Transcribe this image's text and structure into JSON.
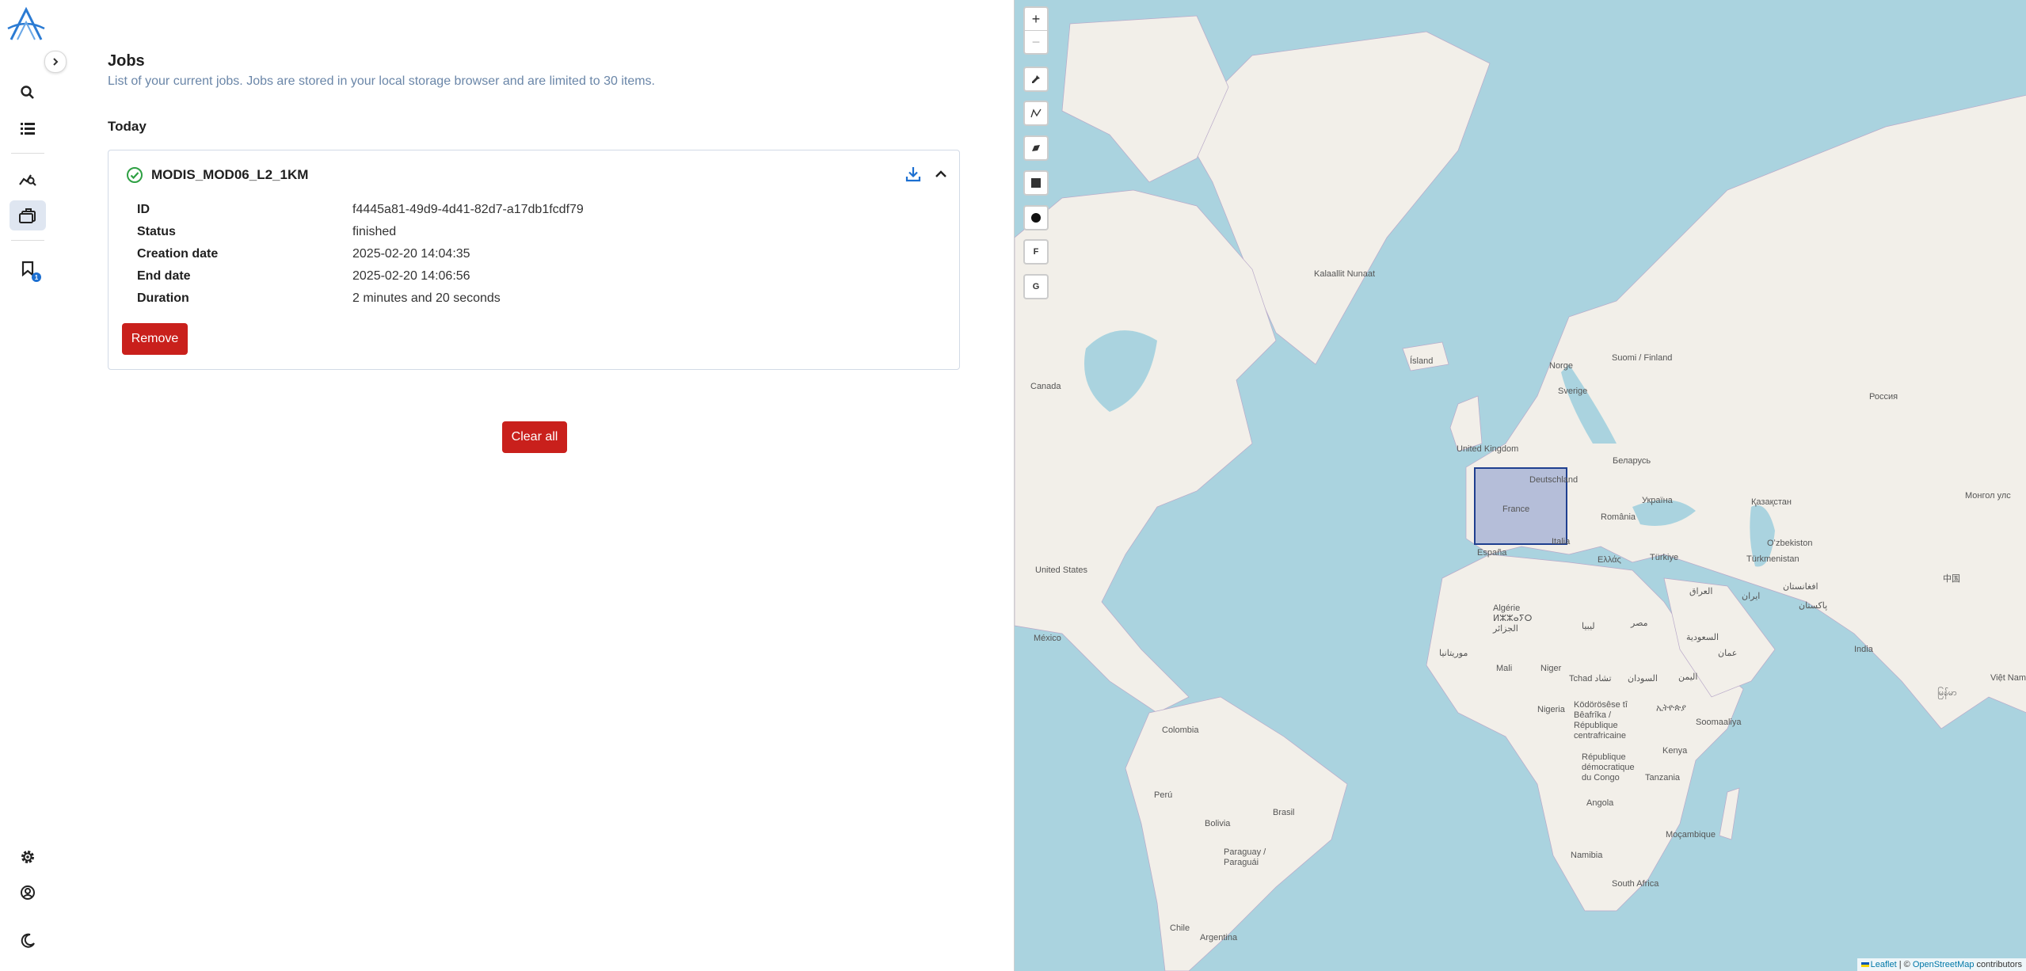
{
  "app": {
    "logo_icon": "app-logo-icon"
  },
  "rail": {
    "expand_icon": "chevron-right-icon",
    "items": [
      {
        "icon": "search-icon"
      },
      {
        "icon": "layers-list-icon"
      },
      {
        "icon": "analytics-icon"
      },
      {
        "icon": "jobs-briefcase-icon",
        "active": true
      },
      {
        "icon": "bookmark-icon",
        "badge": "1"
      }
    ],
    "bottom": [
      {
        "icon": "gear-icon"
      },
      {
        "icon": "user-account-icon"
      },
      {
        "icon": "dark-mode-moon-icon"
      }
    ]
  },
  "jobs": {
    "title": "Jobs",
    "subtitle": "List of your current jobs. Jobs are stored in your local storage browser and are limited to 30 items.",
    "section": "Today",
    "job": {
      "name": "MODIS_MOD06_L2_1KM",
      "status_icon": "check-circle-icon",
      "fields": [
        {
          "label": "ID",
          "value": "f4445a81-49d9-4d41-82d7-a17db1fcdf79"
        },
        {
          "label": "Status",
          "value": "finished"
        },
        {
          "label": "Creation date",
          "value": "2025-02-20 14:04:35"
        },
        {
          "label": "End date",
          "value": "2025-02-20 14:06:56"
        },
        {
          "label": "Duration",
          "value": "2 minutes and 20 seconds"
        }
      ],
      "remove_label": "Remove"
    },
    "clear_all_label": "Clear all"
  },
  "map": {
    "zoom_in": "+",
    "zoom_out": "−",
    "tools": [
      "marker-icon",
      "polyline-icon",
      "polygon-icon",
      "rectangle-icon",
      "circle-icon"
    ],
    "tool_f": "F",
    "tool_g": "G",
    "labels": {
      "kalaallit": "Kalaallit Nunaat",
      "island": "Ísland",
      "norge": "Norge",
      "suomi": "Suomi / Finland",
      "sverige": "Sverige",
      "rossiya": "Россия",
      "canada": "Canada",
      "uk": "United Kingdom",
      "belarus": "Беларусь",
      "deutschland": "Deutschland",
      "ukraina": "Україна",
      "kazakhstan": "Қазақстан",
      "mongol": "Монгол улс",
      "france": "France",
      "romania": "România",
      "uzbekistan": "Oʻzbekiston",
      "espana": "España",
      "ellas": "Ελλάς",
      "turkiye": "Türkiye",
      "turkmenistan": "Türkmenistan",
      "usa": "United States",
      "china": "中国",
      "iraq": "العراق",
      "iran": "ایران",
      "afghanistan": "افغانستان",
      "pakistan": "پاکستان",
      "algerie": "Algérie ⵍⵣⵣⴰⵢⵔ الجزائر",
      "libya": "ليبيا",
      "misr": "مصر",
      "mexico": "México",
      "saudi": "السعودية",
      "india": "India",
      "mauritania": "موريتانيا",
      "mali": "Mali",
      "niger": "Niger",
      "tchad": "Tchad تشاد",
      "sudan": "السودان",
      "yemen": "اليمن",
      "oman": "عمان",
      "vietnam": "Việt Nam",
      "nigeria": "Nigeria",
      "ethiopia": "ኢትዮጵያ",
      "somalia": "Soomaaliya",
      "kodrosese": "Ködörösêse tî Bêafrîka / République centrafricaine",
      "colombia": "Colombia",
      "kenya": "Kenya",
      "rdc": "République démocratique du Congo",
      "peru": "Perú",
      "brasil": "Brasil",
      "tanzania": "Tanzania",
      "bolivia": "Bolivia",
      "angola": "Angola",
      "mocambique": "Moçambique",
      "paraguay": "Paraguay / Paraguái",
      "namibia": "Namibia",
      "south_africa": "South Africa",
      "chile": "Chile",
      "argentina": "Argentina",
      "myanmar": "မြန်မာ",
      "italia": "Italia"
    },
    "attribution": {
      "leaflet": "Leaflet",
      "separator": " | © ",
      "osm": "OpenStreetMap",
      "suffix": " contributors"
    }
  }
}
